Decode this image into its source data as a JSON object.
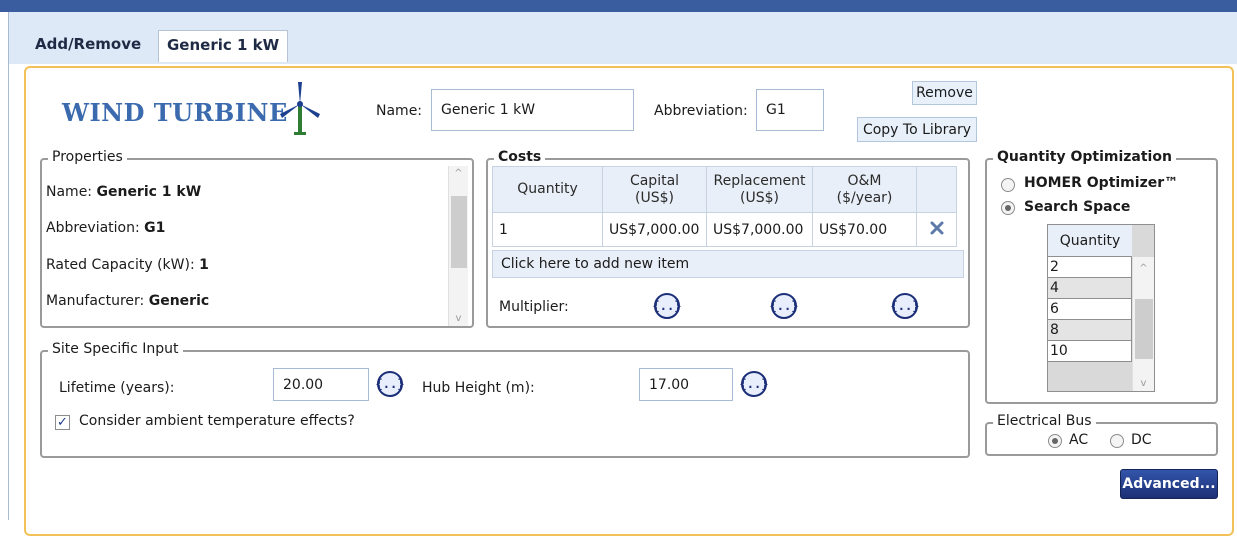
{
  "tabs": [
    "Add/Remove",
    "Generic 1 kW"
  ],
  "header": {
    "title": "WIND TURBINE",
    "name_label": "Name:",
    "name_value": "Generic 1 kW",
    "abbrev_label": "Abbreviation:",
    "abbrev_value": "G1",
    "remove_button": "Remove",
    "copy_button": "Copy To Library"
  },
  "properties": {
    "legend": "Properties",
    "lines": [
      {
        "label": "Name: ",
        "value": "Generic 1 kW"
      },
      {
        "label": "Abbreviation: ",
        "value": "G1"
      },
      {
        "label": "Rated Capacity (kW): ",
        "value": "1"
      },
      {
        "label": "Manufacturer: ",
        "value": "Generic"
      }
    ]
  },
  "costs": {
    "legend": "Costs",
    "headers": [
      "Quantity",
      "Capital",
      "(US$)",
      "Replacement",
      "(US$)",
      "O&M",
      "($/year)"
    ],
    "row": {
      "quantity": "1",
      "capital": "US$7,000.00",
      "replacement": "US$7,000.00",
      "om": "US$70.00"
    },
    "add_item": "Click here to add new item",
    "multiplier_label": "Multiplier:",
    "brace_glyph": "{..}"
  },
  "quantity_optimization": {
    "legend": "Quantity Optimization",
    "option1": "HOMER Optimizer™",
    "option2": "Search Space",
    "selected": "Search Space",
    "column_header": "Quantity",
    "values": [
      "2",
      "4",
      "6",
      "8",
      "10"
    ]
  },
  "site": {
    "legend": "Site Specific Input",
    "lifetime_label": "Lifetime (years):",
    "lifetime_value": "20.00",
    "hub_label": "Hub Height (m):",
    "hub_value": "17.00",
    "temp_label": "Consider ambient temperature effects?",
    "temp_checked": true
  },
  "bus": {
    "legend": "Electrical Bus",
    "ac": "AC",
    "dc": "DC",
    "selected": "AC"
  },
  "advanced_button": "Advanced...",
  "colors": {
    "accent": "#f2c15a",
    "title": "#3b6bae",
    "header_bar": "#3a5d9f",
    "button": "#1b2f75"
  }
}
